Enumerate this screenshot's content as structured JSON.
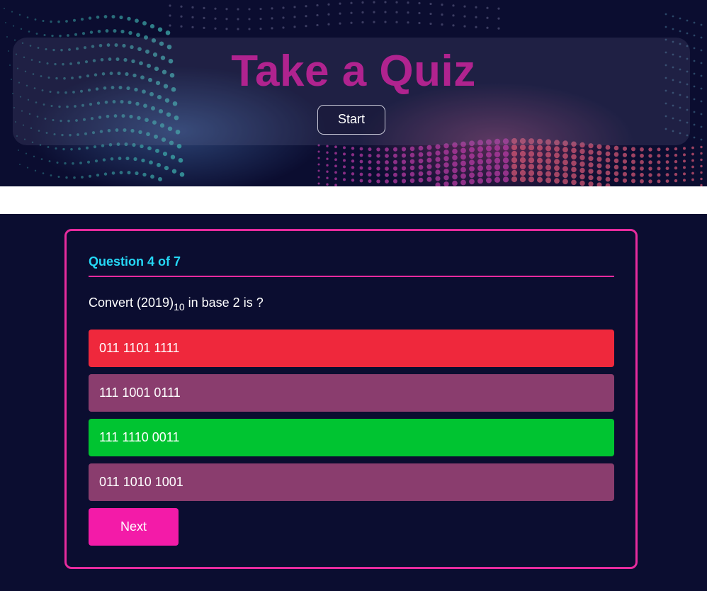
{
  "hero": {
    "title": "Take a Quiz",
    "start_label": "Start"
  },
  "quiz": {
    "counter": "Question 4 of 7",
    "question_prefix": "Convert (2019)",
    "question_subscript": "10",
    "question_suffix": " in base 2 is ?",
    "options": [
      {
        "label": "011 1101 1111",
        "state": "incorrect",
        "color": "#ef283c"
      },
      {
        "label": "111 1001 0111",
        "state": "neutral",
        "color": "#8a3d6e"
      },
      {
        "label": "111 1110 0011",
        "state": "correct",
        "color": "#00c431"
      },
      {
        "label": "011 1010 1001",
        "state": "neutral",
        "color": "#8a3d6e"
      }
    ],
    "next_label": "Next"
  },
  "colors": {
    "background": "#0b0d30",
    "accent_pink": "#e72b9e",
    "counter_cyan": "#25d7f5",
    "title_magenta": "#b0238f",
    "next_button": "#f31ba8"
  }
}
